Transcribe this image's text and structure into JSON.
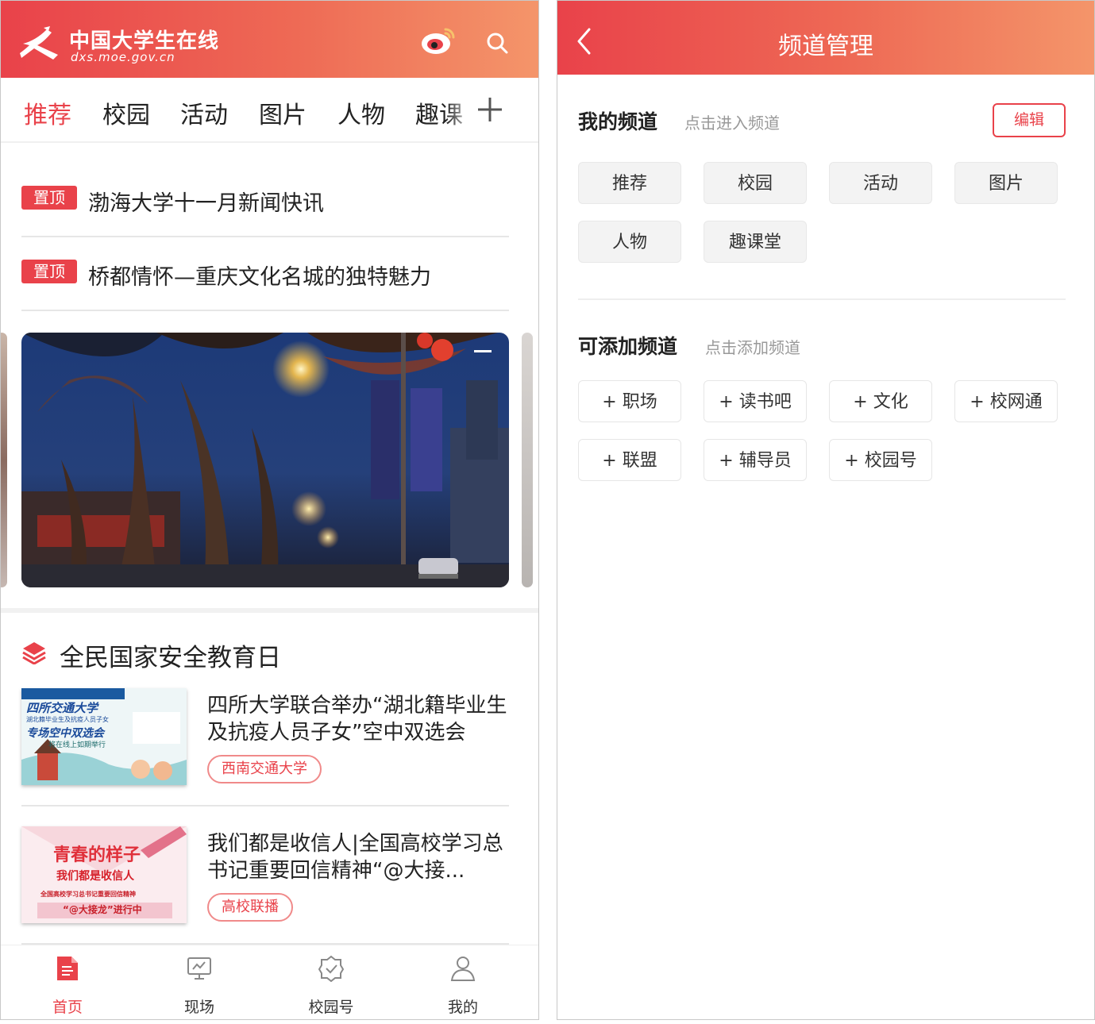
{
  "colors": {
    "accent": "#e9424a",
    "header_gradient_start": "#e9424a",
    "header_gradient_end": "#f4956a"
  },
  "home": {
    "logo": {
      "name": "中国大学生在线",
      "url": "dxs.moe.gov.cn"
    },
    "tabs": [
      {
        "label": "推荐",
        "active": true
      },
      {
        "label": "校园",
        "active": false
      },
      {
        "label": "活动",
        "active": false
      },
      {
        "label": "图片",
        "active": false
      },
      {
        "label": "人物",
        "active": false
      },
      {
        "label": "趣课",
        "active": false
      }
    ],
    "pinned": [
      {
        "badge": "置顶",
        "title": "渤海大学十一月新闻快讯"
      },
      {
        "badge": "置顶",
        "title": "桥都情怀—重庆文化名城的独特魅力"
      }
    ],
    "section": {
      "title": "全民国家安全教育日"
    },
    "news": [
      {
        "title": "四所大学联合举办“湖北籍毕业生及抗疫人员子女”空中双选会",
        "tag": "西南交通大学",
        "thumb": {
          "line1": "四所交通大学",
          "line2": "湖北籍毕业生及抗疫人员子女",
          "line3": "专场空中双选会",
          "line4": "将在线上如期举行"
        }
      },
      {
        "title": "我们都是收信人|全国高校学习总书记重要回信精神“@大接...",
        "tag": "高校联播",
        "thumb": {
          "line1": "青春的样子",
          "line2": "我们都是收信人",
          "line3": "全国高校学习总书记重要回信精神",
          "line4": "“@大接龙”进行中"
        }
      }
    ],
    "bottom_nav": [
      {
        "label": "首页",
        "icon": "home-doc-icon",
        "active": true
      },
      {
        "label": "现场",
        "icon": "monitor-icon",
        "active": false
      },
      {
        "label": "校园号",
        "icon": "badge-check-icon",
        "active": false
      },
      {
        "label": "我的",
        "icon": "user-icon",
        "active": false
      }
    ]
  },
  "channels": {
    "title": "频道管理",
    "my": {
      "title": "我的频道",
      "hint": "点击进入频道",
      "edit_label": "编辑",
      "items": [
        "推荐",
        "校园",
        "活动",
        "图片",
        "人物",
        "趣课堂"
      ]
    },
    "available": {
      "title": "可添加频道",
      "hint": "点击添加频道",
      "items": [
        "+ 职场",
        "+ 读书吧",
        "+ 文化",
        "+ 校网通",
        "+ 联盟",
        "+ 辅导员",
        "+ 校园号"
      ]
    }
  }
}
